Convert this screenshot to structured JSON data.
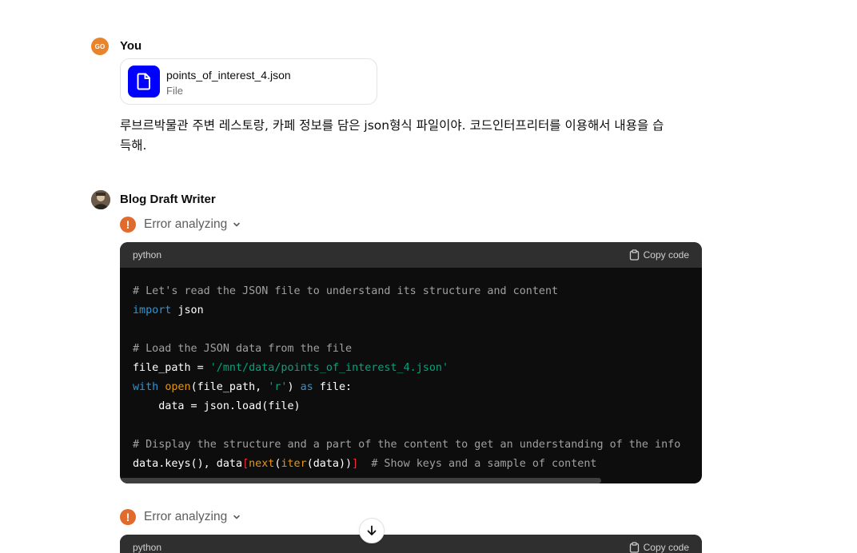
{
  "user_message": {
    "avatar_initials": "GO",
    "author": "You",
    "attachment": {
      "file_name": "points_of_interest_4.json",
      "file_type": "File"
    },
    "text": "루브르박물관 주변 레스토랑, 카페 정보를 담은 json형식 파일이야. 코드인터프리터를 이용해서 내용을 습득해."
  },
  "assistant_message": {
    "author": "Blog Draft Writer",
    "blocks": [
      {
        "status_label": "Error analyzing",
        "language": "python",
        "copy_label": "Copy code",
        "lines": [
          "# Let's read the JSON file to understand its structure and content",
          "import json",
          "",
          "# Load the JSON data from the file",
          "file_path = '/mnt/data/points_of_interest_4.json'",
          "with open(file_path, 'r') as file:",
          "    data = json.load(file)",
          "",
          "# Display the structure and a part of the content to get an understanding of the info",
          "data.keys(), data[next(iter(data))]  # Show keys and a sample of content"
        ]
      },
      {
        "status_label": "Error analyzing",
        "language": "python",
        "copy_label": "Copy code"
      }
    ]
  },
  "colors": {
    "user_avatar": "#e8842c",
    "file_icon_bg": "#0000ff",
    "error_icon": "#e06b2c",
    "code_bg": "#0d0d0d",
    "code_header_bg": "#2f2f2f"
  },
  "icons": {
    "file": "file-icon",
    "error": "exclamation-icon",
    "expand": "chevron-down-icon",
    "copy": "clipboard-icon",
    "scroll_down": "arrow-down-icon"
  }
}
